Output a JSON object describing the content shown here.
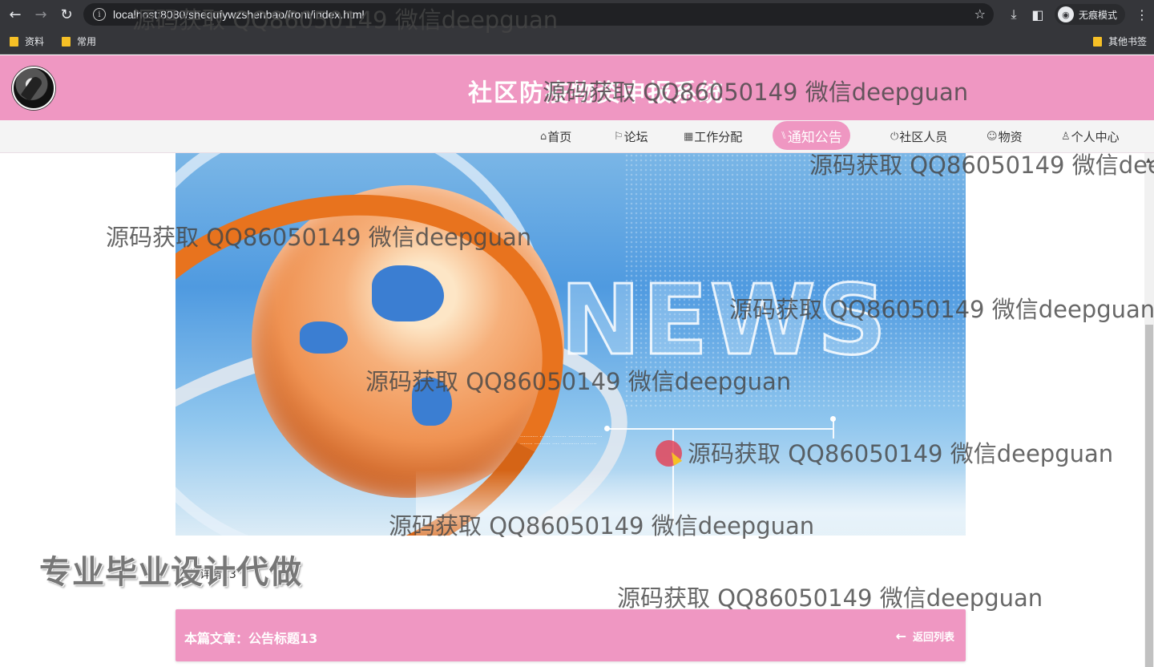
{
  "browser": {
    "url": "localhost:8080/shequfywzshenbao/front/index.html",
    "incognito_label": "无痕模式",
    "bookmarks": [
      "资料",
      "常用"
    ],
    "other_bookmarks": "其他书签"
  },
  "site": {
    "title": "社区防疫物资申报系统"
  },
  "nav": {
    "items": [
      {
        "icon": "⌂",
        "label": "首页"
      },
      {
        "icon": "⚐",
        "label": "论坛"
      },
      {
        "icon": "▦",
        "label": "工作分配"
      },
      {
        "icon": "⑊",
        "label": "通知公告"
      },
      {
        "icon": "⏻",
        "label": "社区人员"
      },
      {
        "icon": "☺",
        "label": "物资"
      },
      {
        "icon": "♙",
        "label": "个人中心"
      }
    ],
    "active_index": 3
  },
  "banner": {
    "headline": "NEWS"
  },
  "content": {
    "detail_label": "公告详情13",
    "current_article": "本篇文章：公告标题13",
    "back_label": "返回列表"
  },
  "overlay": {
    "promo": "专业毕业设计代做",
    "watermark": "源码获取 QQ86050149 微信deepguan"
  },
  "colors": {
    "accent": "#ef97c2",
    "chrome": "#35363a"
  }
}
